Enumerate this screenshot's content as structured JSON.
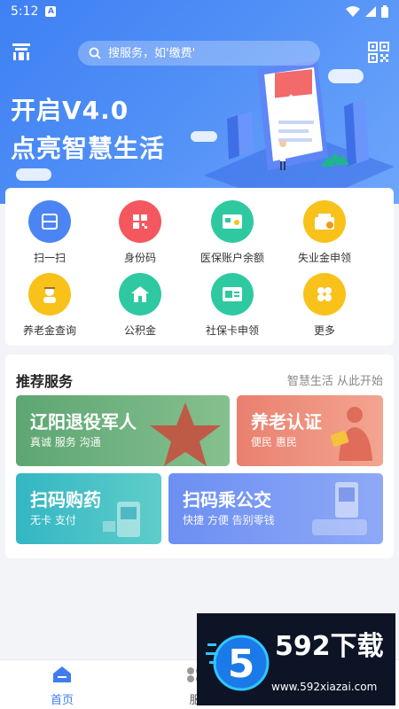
{
  "status_bar": {
    "time": "5:12",
    "badge": "A"
  },
  "search": {
    "placeholder": "搜服务，如'缴费'"
  },
  "hero": {
    "line1": "开启V4.0",
    "line2": "点亮智慧生活"
  },
  "services": [
    {
      "label": "扫一扫",
      "color": "#4c85f3",
      "icon": "scan-icon"
    },
    {
      "label": "身份码",
      "color": "#f5575f",
      "icon": "id-code-icon"
    },
    {
      "label": "医保账户余额",
      "color": "#2ec9a1",
      "icon": "medical-card-icon"
    },
    {
      "label": "失业金申领",
      "color": "#f8c21a",
      "icon": "wallet-icon"
    },
    {
      "label": "养老金查询",
      "color": "#f8c21a",
      "icon": "elder-icon"
    },
    {
      "label": "公积金",
      "color": "#2ec9a1",
      "icon": "house-icon"
    },
    {
      "label": "社保卡申领",
      "color": "#2ec9a1",
      "icon": "social-card-icon"
    },
    {
      "label": "更多",
      "color": "#f8c21a",
      "icon": "more-icon"
    }
  ],
  "recommend": {
    "title": "推荐服务",
    "subtitle": "智慧生活 从此开始",
    "tiles": [
      {
        "title": "辽阳退役军人",
        "subtitle": "真诚 服务 沟通",
        "color": "#5da672"
      },
      {
        "title": "养老认证",
        "subtitle": "便民 惠民",
        "color": "#ea8574"
      },
      {
        "title": "扫码购药",
        "subtitle": "无卡 支付",
        "color": "#3ebcc4"
      },
      {
        "title": "扫码乘公交",
        "subtitle": "快捷 方便 告别零钱",
        "color": "#6f93f2"
      }
    ]
  },
  "bottom_nav": {
    "items": [
      {
        "label": "首页",
        "active": true
      },
      {
        "label": "服"
      }
    ]
  },
  "watermark": {
    "main": "592下载",
    "url": "www.592xiazai.com",
    "number": "5"
  }
}
